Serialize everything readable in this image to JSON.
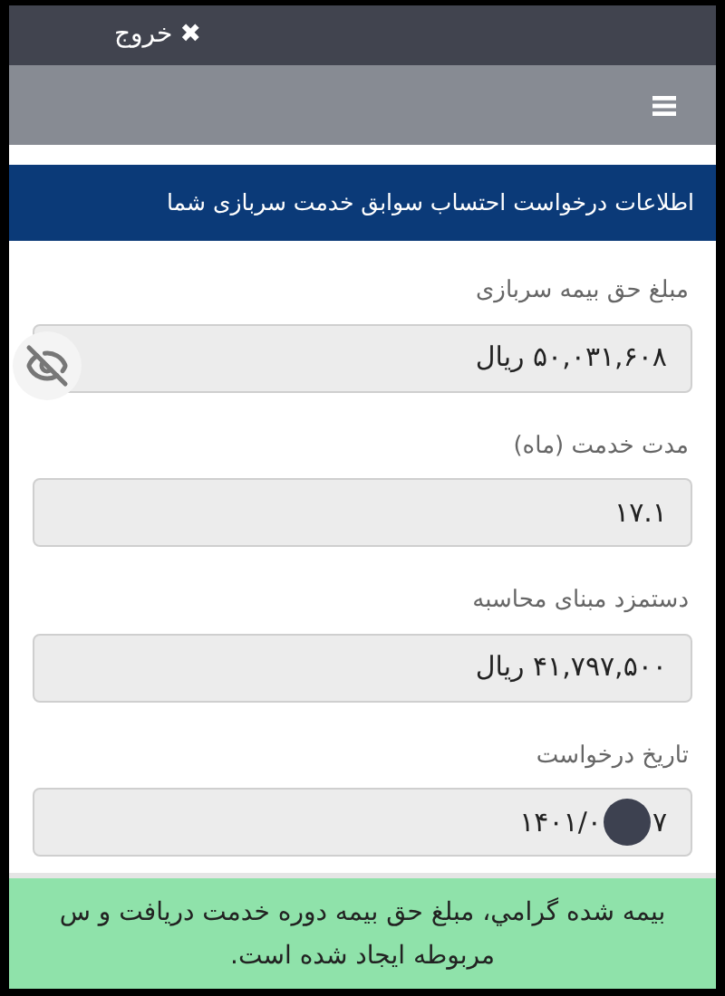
{
  "top_bar": {
    "exit_icon": "✖",
    "exit_label": "خروج"
  },
  "section_title": "اطلاعات درخواست احتساب سوابق خدمت سربازی شما",
  "fields": [
    {
      "kind": "text",
      "label": "مبلغ حق بیمه سربازی",
      "value": "۵۰,۰۳۱,۶۰۸ ریال"
    },
    {
      "kind": "text",
      "label": "مدت خدمت (ماه)",
      "value": "۱۷.۱"
    },
    {
      "kind": "text",
      "label": "دستمزد مبنای محاسبه",
      "value": "۴۱,۷۹۷,۵۰۰ ریال"
    },
    {
      "kind": "redacted",
      "label": "تاریخ درخواست",
      "value_start": "۱۴۰۱/۰",
      "value_end": "۷"
    }
  ],
  "message": [
    "بیمه شده گرامي، مبلغ حق بیمه دوره خدمت دریافت و س",
    "مربوطه ایجاد شده است."
  ]
}
